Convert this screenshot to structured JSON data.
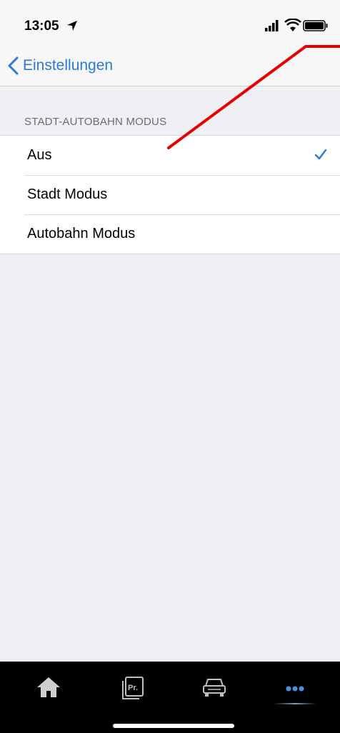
{
  "status_bar": {
    "time": "13:05"
  },
  "nav": {
    "back_label": "Einstellungen"
  },
  "section": {
    "header": "STADT-AUTOBAHN MODUS"
  },
  "options": [
    {
      "label": "Aus",
      "selected": true
    },
    {
      "label": "Stadt Modus",
      "selected": false
    },
    {
      "label": "Autobahn Modus",
      "selected": false
    }
  ],
  "tab_bar": {
    "tabs": [
      {
        "icon": "home-icon"
      },
      {
        "icon": "profile-pr-icon"
      },
      {
        "icon": "car-icon"
      },
      {
        "icon": "more-dots-icon",
        "active": true
      }
    ],
    "active_color": "#4a90e2"
  },
  "colors": {
    "accent": "#2b7bd6",
    "annotation_line": "#e60000"
  }
}
